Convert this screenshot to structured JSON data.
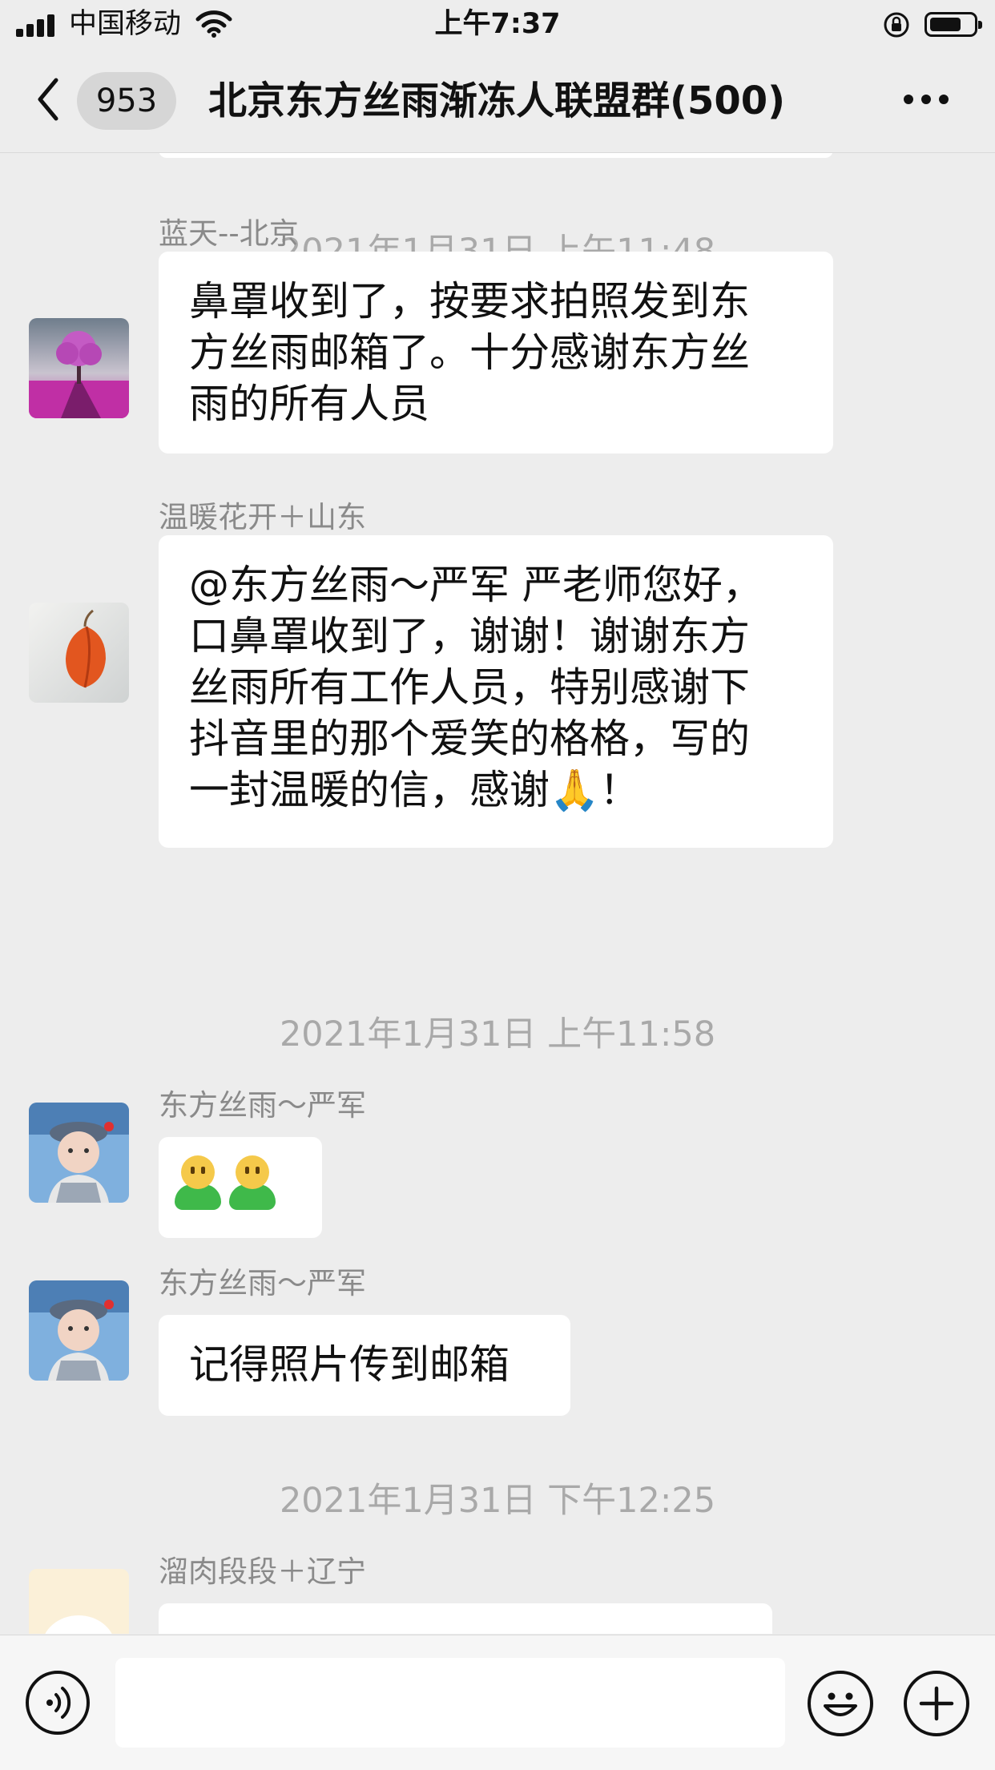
{
  "status_bar": {
    "carrier": "中国移动",
    "time": "上午7:37",
    "icons": [
      "signal-icon",
      "wifi-icon",
      "orientation-lock-icon",
      "battery-icon"
    ]
  },
  "nav": {
    "back_icon": "chevron-left-icon",
    "unread_count": "953",
    "title": "北京东方丝雨渐冻人联盟群(500)",
    "more_icon": "more-dots-icon"
  },
  "timestamps": {
    "t1": "2021年1月31日 上午11:48",
    "t2": "2021年1月31日 上午11:58",
    "t3": "2021年1月31日 下午12:25"
  },
  "messages": [
    {
      "sender": "蓝天--北京",
      "lines": [
        "鼻罩收到了，按要求拍照发到东",
        "方丝雨邮箱了。十分感谢东方丝",
        "雨的所有人员"
      ]
    },
    {
      "sender": "温暖花开＋山东",
      "lines": [
        "@东方丝雨～严军 严老师您好，",
        "口鼻罩收到了，谢谢！谢谢东方",
        "丝雨所有工作人员，特别感谢下",
        "抖音里的那个爱笑的格格，写的",
        "一封温暖的信，感谢🙏！"
      ]
    },
    {
      "sender": "东方丝雨～严军",
      "lines": [
        "🤐🤐"
      ],
      "emoji_names": [
        "person-green-shirt-emoji",
        "person-green-shirt-emoji"
      ]
    },
    {
      "sender": "东方丝雨～严军",
      "lines": [
        "记得照片传到邮箱"
      ]
    },
    {
      "sender": "溜肉段段＋辽宁",
      "lines": [
        ""
      ]
    }
  ],
  "input_bar": {
    "placeholder": "",
    "voice_icon": "voice-icon",
    "emoji_icon": "emoji-icon",
    "add_icon": "plus-icon"
  },
  "colors": {
    "background": "#ededed",
    "bubble": "#ffffff",
    "timestamp": "#a9a9a9",
    "sender": "#8a8a8a"
  }
}
